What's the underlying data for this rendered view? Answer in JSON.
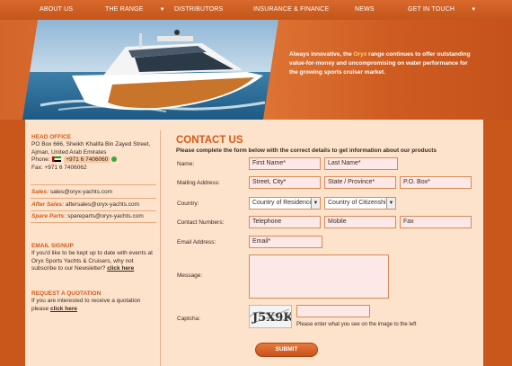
{
  "nav": {
    "items": [
      {
        "label": "ABOUT US",
        "caret": ""
      },
      {
        "label": "THE RANGE",
        "caret": "▼"
      },
      {
        "label": "DISTRIBUTORS",
        "caret": ""
      },
      {
        "label": "INSURANCE & FINANCE",
        "caret": ""
      },
      {
        "label": "NEWS",
        "caret": ""
      },
      {
        "label": "GET IN TOUCH",
        "caret": "▼"
      }
    ]
  },
  "hero": {
    "text_before": "Always innovative, the ",
    "brand": "Oryx",
    "text_after": " range continues to offer outstanding value-for-money and uncompromising on water performance for the growing sports cruiser market."
  },
  "sidebar": {
    "head_office_title": "HEAD OFFICE",
    "address_line1": "PO Box 666, Sheikh Khalifa Bin Zayed Street,",
    "address_line2": "Ajman, United Arab Emirates",
    "phone_label": "Phone:",
    "phone_value": "+971 6 7406060",
    "fax": "Fax: +971 6 7406062",
    "contacts": [
      {
        "label": "Sales:",
        "value": "sales@oryx-yachts.com"
      },
      {
        "label": "After Sales:",
        "value": "aftersales@oryx-yachts.com"
      },
      {
        "label": "Spare Parts:",
        "value": "spareparts@oryx-yachts.com"
      }
    ],
    "email_signup_title": "EMAIL SIGNUP",
    "email_signup_text": "If you'd like to be kept up to date with events at Oryx Sports Yachts & Cruisers, why not subscribe to our Newsletter?",
    "email_signup_link": "click here",
    "quote_title": "REQUEST A QUOTATION",
    "quote_text": "If you are interested to receive a quotation please",
    "quote_link": "click here"
  },
  "form": {
    "title": "CONTACT US",
    "intro": "Please complete the form below with the correct details to get information about our products",
    "labels": {
      "name": "Name:",
      "mailing": "Mailing Address:",
      "country": "Country:",
      "contact_numbers": "Contact Numbers:",
      "email": "Email Address:",
      "message": "Message:",
      "captcha": "Captcha:"
    },
    "fields": {
      "first_name": "First Name*",
      "last_name": "Last Name*",
      "street": "Street, City*",
      "state": "State / Province*",
      "pobox": "P.O. Box*",
      "country_residence": "Country of Residence",
      "country_citizenship": "Country of Citizenship",
      "telephone": "Telephone",
      "mobile": "Mobile",
      "fax": "Fax",
      "email": "Email*",
      "message": "",
      "captcha": ""
    },
    "captcha_text": "J5X9K",
    "captcha_hint": "Please enter what you see on the image to the left",
    "submit_label": "SUBMIT"
  },
  "colors": {
    "nav_bg": "#c9571c",
    "accent": "#d35a1a",
    "content_bg": "#fde3cc",
    "field_bg": "#fce8e6"
  }
}
